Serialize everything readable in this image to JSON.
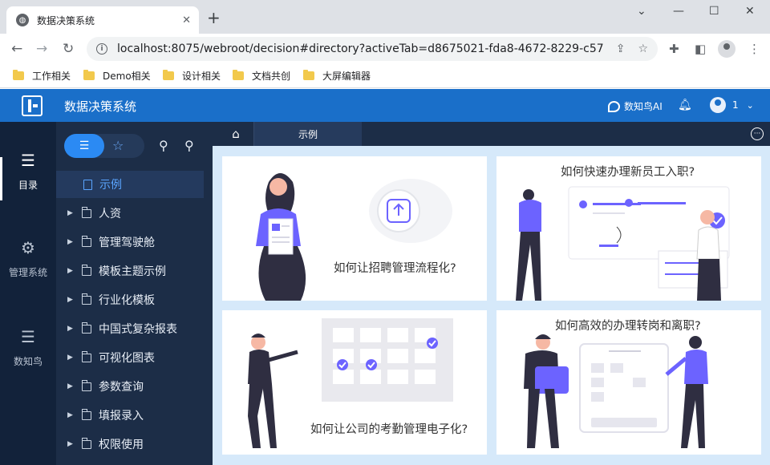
{
  "browser": {
    "tab_title": "数据决策系统",
    "url": "localhost:8075/webroot/decision#directory?activeTab=d8675021-fda8-4672-8229-c578c...",
    "bookmarks": [
      "工作相关",
      "Demo相关",
      "设计相关",
      "文档共创",
      "大屏编辑器"
    ]
  },
  "app": {
    "title": "数据决策系统",
    "ai_label": "数知鸟AI",
    "user_name": "1"
  },
  "rail": {
    "items": [
      "目录",
      "管理系统",
      "数知鸟"
    ]
  },
  "directory": {
    "selected": "示例",
    "items": [
      "人资",
      "管理驾驶舱",
      "模板主题示例",
      "行业化模板",
      "中国式复杂报表",
      "可视化图表",
      "参数查询",
      "填报录入",
      "权限使用"
    ]
  },
  "tabs": {
    "active": "示例"
  },
  "cards": [
    {
      "title": "如何让招聘管理流程化?"
    },
    {
      "title": "如何快速办理新员工入职?"
    },
    {
      "title": "如何让公司的考勤管理电子化?"
    },
    {
      "title": "如何高效的办理转岗和离职?"
    }
  ],
  "colors": {
    "brand": "#1a6fc9",
    "sidebar": "#1c2d47",
    "accent": "#2b8af3",
    "illustration": "#6c63ff"
  }
}
